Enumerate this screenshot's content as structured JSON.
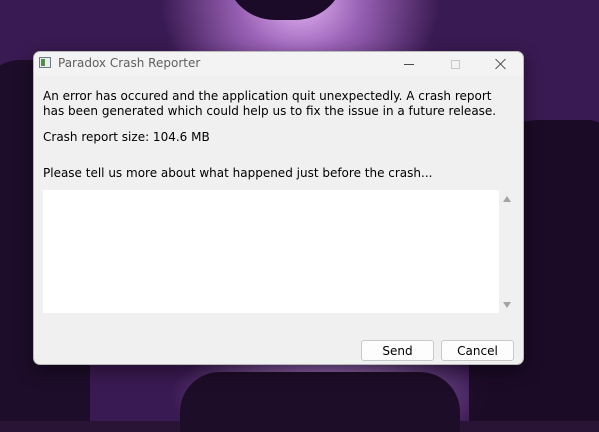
{
  "window": {
    "title": "Paradox Crash Reporter",
    "icon": "app-window-icon",
    "controls": {
      "minimize": "minimize-icon",
      "maximize": "maximize-icon",
      "close": "close-icon"
    }
  },
  "content": {
    "error_message": "An error has occured and the application quit unexpectedly. A crash report has been generated which could help us to fix the issue in a future release.",
    "report_size": "Crash report size: 104.6 MB",
    "prompt": "Please tell us more about what happened just before the crash...",
    "details_value": ""
  },
  "buttons": {
    "send": "Send",
    "cancel": "Cancel"
  },
  "colors": {
    "wallpaper_accent": "#7a4a9a",
    "dialog_background": "#f0f0f0"
  }
}
